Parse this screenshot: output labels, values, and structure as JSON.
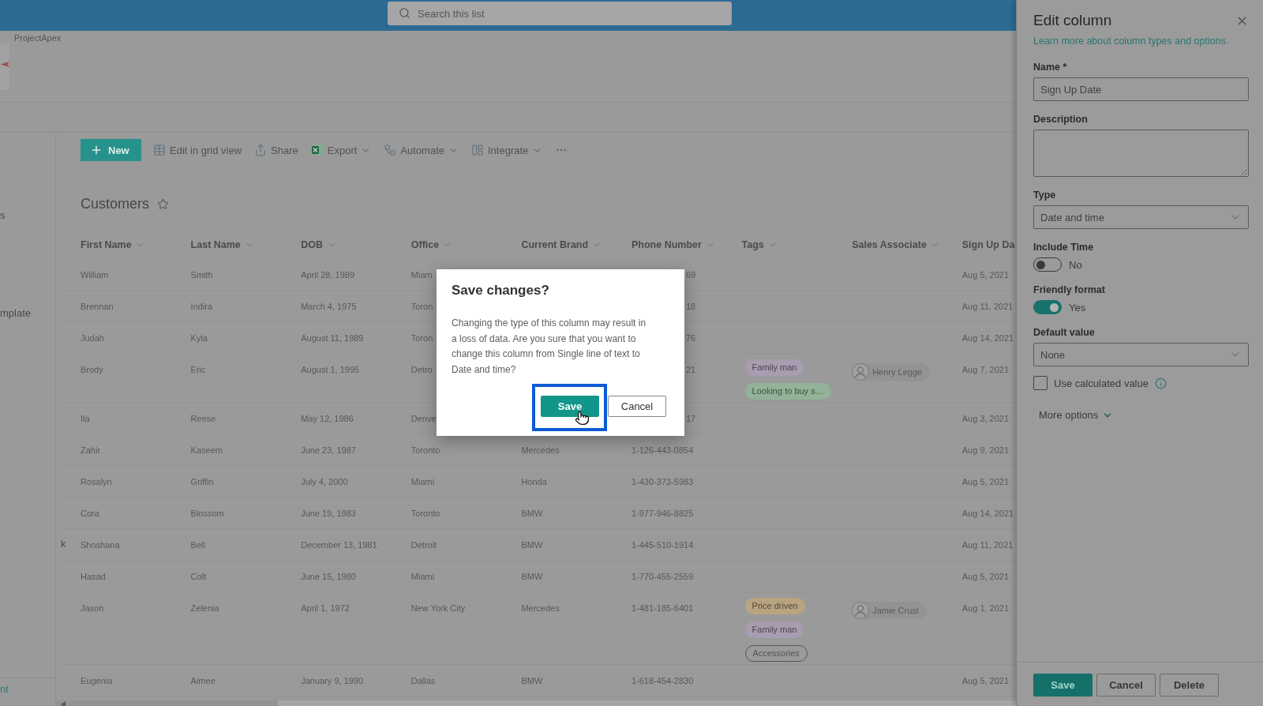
{
  "top_bar": {
    "search": {
      "placeholder": "Search this list"
    }
  },
  "site": {
    "name": "ProjectApex"
  },
  "left_nav": {
    "items": [
      "s",
      "mplate"
    ],
    "footer_link": "nt"
  },
  "toolbar": {
    "items": [
      {
        "kind": "primary",
        "label": "New",
        "has_menu": false
      },
      {
        "kind": "command",
        "label": "Edit in grid view",
        "has_menu": false
      },
      {
        "kind": "command",
        "label": "Share",
        "has_menu": false
      },
      {
        "kind": "command",
        "label": "Export",
        "has_menu": true
      },
      {
        "kind": "command",
        "label": "Automate",
        "has_menu": true
      },
      {
        "kind": "command",
        "label": "Integrate",
        "has_menu": true
      },
      {
        "kind": "overflow",
        "has_menu": false
      }
    ]
  },
  "list": {
    "title": "Customers",
    "favorite": false
  },
  "table": {
    "columns": [
      "First Name",
      "Last Name",
      "DOB",
      "Office",
      "Current Brand",
      "Phone Number",
      "Tags",
      "Sales Associate",
      "Sign Up Da"
    ],
    "rows": [
      {
        "first_name": "William",
        "last_name": "Smith",
        "dob": "April 28, 1989",
        "office": "Miam",
        "phone_number": "69",
        "column_9": "Aug 5, 2021"
      },
      {
        "first_name": "Brennan",
        "last_name": "Indira",
        "dob": "March 4, 1975",
        "office": "Toron",
        "phone_number": "18",
        "column_9": "Aug 11, 2021"
      },
      {
        "first_name": "Judah",
        "last_name": "Kyla",
        "dob": "August 11, 1989",
        "office": "Toron",
        "phone_number": "76",
        "column_9": "Aug 14, 2021"
      },
      {
        "first_name": "Brody",
        "last_name": "Eric",
        "dob": "August 1, 1995",
        "office": "Detro",
        "phone_number": "21",
        "tags": [
          {
            "label": "Family man",
            "kind": "filled",
            "color": "#a89cb0"
          },
          {
            "label": "Looking to buy s…",
            "kind": "filled",
            "color": "#93b297"
          }
        ],
        "sales_associate": "Henry Legge",
        "column_9": "Aug 7, 2021"
      },
      {
        "first_name": "Ila",
        "last_name": "Reese",
        "dob": "May 12, 1986",
        "office": "Denve",
        "phone_number": "17",
        "column_9": "Aug 3, 2021"
      },
      {
        "first_name": "Zahir",
        "last_name": "Kaseem",
        "dob": "June 23, 1987",
        "office": "Toronto",
        "current_brand": "Mercedes",
        "phone_number": "1-126-443-0854",
        "column_9": "Aug 9, 2021"
      },
      {
        "first_name": "Rosalyn",
        "last_name": "Griffin",
        "dob": "July 4, 2000",
        "office": "Miami",
        "current_brand": "Honda",
        "phone_number": "1-430-373-5983",
        "column_9": "Aug 5, 2021"
      },
      {
        "first_name": "Cora",
        "last_name": "Blossom",
        "dob": "June 19, 1983",
        "office": "Toronto",
        "current_brand": "BMW",
        "phone_number": "1-977-946-8825",
        "column_9": "Aug 14, 2021"
      },
      {
        "leading_text": "k",
        "first_name": "Shoshana",
        "last_name": "Bell",
        "dob": "December 13, 1981",
        "office": "Detroit",
        "current_brand": "BMW",
        "phone_number": "1-445-510-1914",
        "column_9": "Aug 11, 2021"
      },
      {
        "first_name": "Hasad",
        "last_name": "Colt",
        "dob": "June 15, 1980",
        "office": "Miami",
        "current_brand": "BMW",
        "phone_number": "1-770-455-2559",
        "column_9": "Aug 5, 2021"
      },
      {
        "first_name": "Jason",
        "last_name": "Zelenia",
        "dob": "April 1, 1972",
        "office": "New York City",
        "current_brand": "Mercedes",
        "phone_number": "1-481-185-6401",
        "tags": [
          {
            "label": "Price driven",
            "kind": "filled",
            "color": "#b8a481"
          },
          {
            "label": "Family man",
            "kind": "filled",
            "color": "#a89cb0"
          },
          {
            "label": "Accessories",
            "kind": "outline"
          }
        ],
        "sales_associate": "Jamie Crust",
        "column_9": "Aug 1, 2021"
      },
      {
        "first_name": "Eugenia",
        "last_name": "Aimee",
        "dob": "January 9, 1990",
        "office": "Dallas",
        "current_brand": "BMW",
        "phone_number": "1-618-454-2830",
        "column_9": "Aug 5, 2021"
      }
    ]
  },
  "dialog": {
    "title": "Save changes?",
    "message": "Changing the type of this column may result in a loss of data. Are you sure that you want to change this column from Single line of text to Date and time?",
    "buttons": [
      {
        "label": "Save",
        "kind": "primary",
        "highlighted": true
      },
      {
        "label": "Cancel",
        "kind": "secondary",
        "highlighted": false
      }
    ]
  },
  "panel": {
    "title": "Edit column",
    "help_link": "Learn more about column types and options.",
    "fields": [
      {
        "kind": "text",
        "label": "Name *",
        "value": "Sign Up Date"
      },
      {
        "kind": "textarea",
        "label": "Description"
      },
      {
        "kind": "select",
        "label": "Type",
        "value": "Date and time"
      },
      {
        "kind": "toggle",
        "label": "Include Time",
        "on": false,
        "state_text": "No"
      },
      {
        "kind": "toggle",
        "label": "Friendly format",
        "on": true,
        "state_text": "Yes"
      },
      {
        "kind": "select",
        "label": "Default value",
        "value": "None"
      },
      {
        "kind": "checkbox",
        "label": "Use calculated value",
        "checked": false
      }
    ],
    "more_options": {
      "label": "More options",
      "expanded": false
    },
    "footer_buttons": [
      {
        "label": "Save",
        "kind": "primary"
      },
      {
        "label": "Cancel",
        "kind": "secondary"
      },
      {
        "label": "Delete",
        "kind": "secondary"
      }
    ]
  }
}
